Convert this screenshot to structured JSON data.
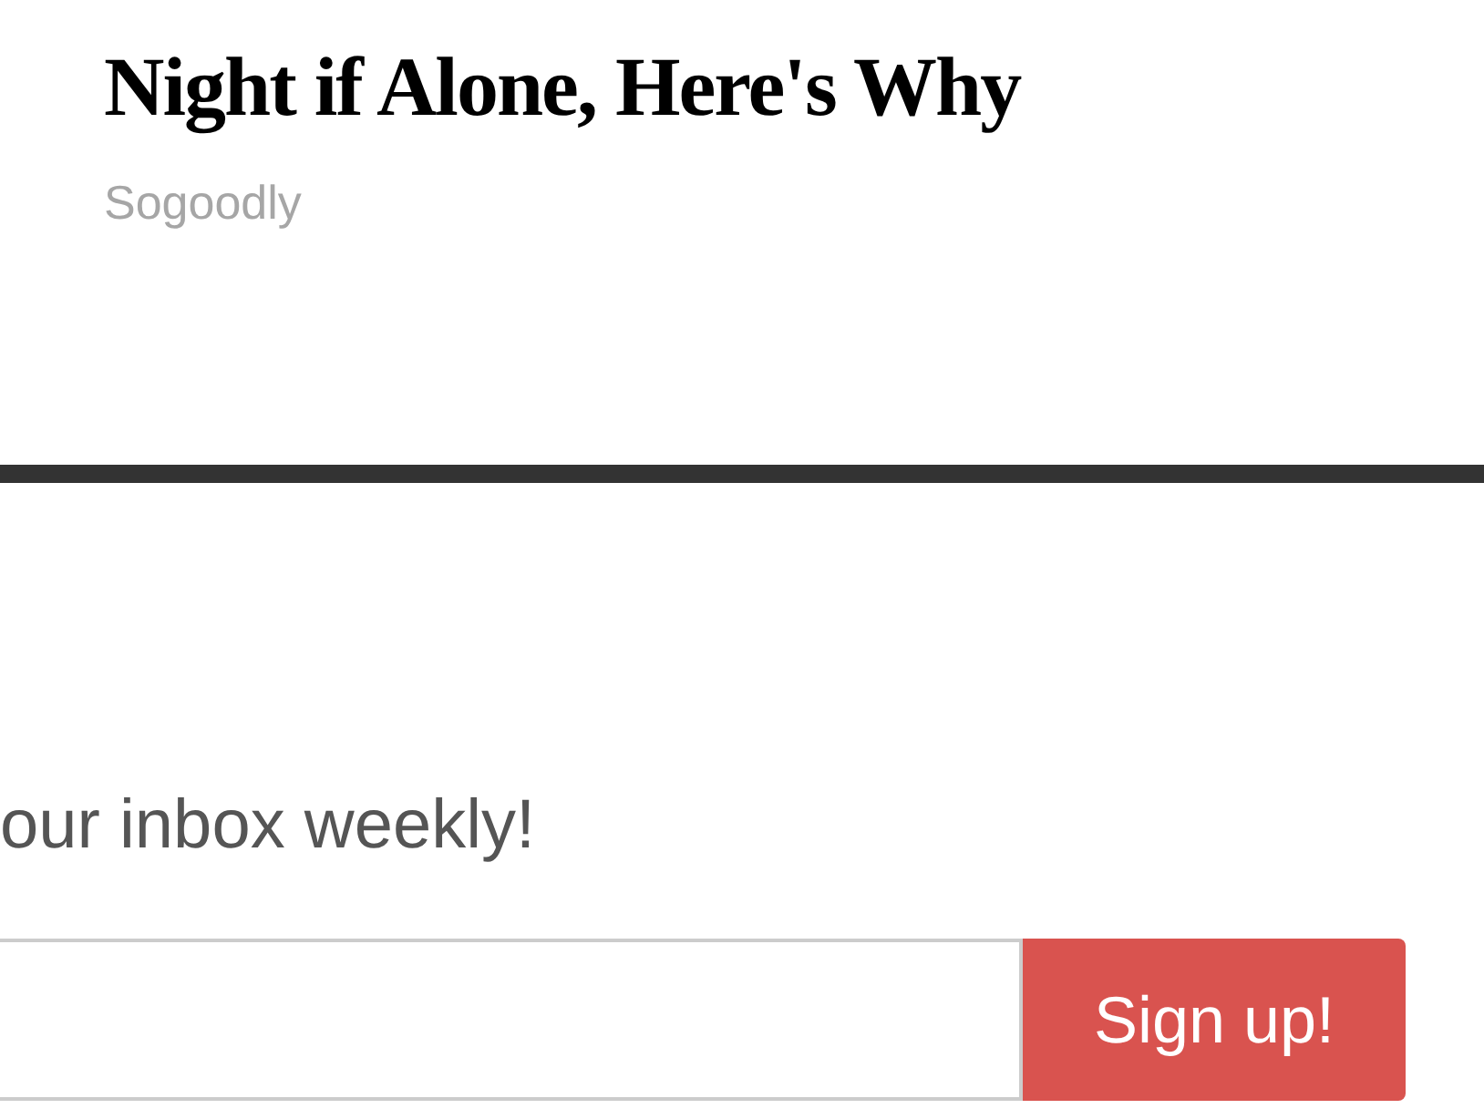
{
  "article": {
    "title": "Night if Alone, Here's Why",
    "source": "Sogoodly"
  },
  "newsletter": {
    "prompt": "our inbox weekly!",
    "button": "Sign up!"
  }
}
